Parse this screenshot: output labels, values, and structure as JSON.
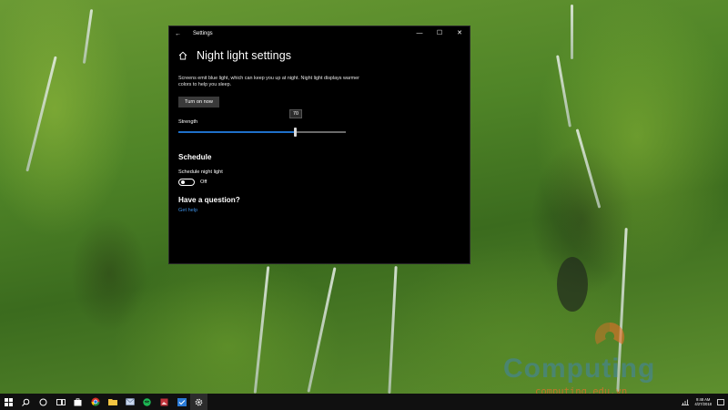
{
  "window": {
    "app_title": "Settings",
    "back_icon": "back-arrow-icon",
    "minimize_glyph": "—",
    "maximize_glyph": "☐",
    "close_glyph": "✕"
  },
  "page": {
    "home_icon": "home-icon",
    "title": "Night light settings",
    "description": "Screens emit blue light, which can keep you up at night. Night light displays warmer colors to help you sleep.",
    "turn_on_label": "Turn on now"
  },
  "strength": {
    "label": "Strength",
    "value": "70",
    "fraction": 0.7
  },
  "schedule": {
    "heading": "Schedule",
    "toggle_label": "Schedule night light",
    "toggle_state": "Off",
    "enabled": false
  },
  "help": {
    "heading": "Have a question?",
    "link_label": "Get help"
  },
  "watermark": {
    "brand": "Computing",
    "url": "computing.edu.vn"
  },
  "taskbar": {
    "items": [
      "windows-logo-icon",
      "search-icon",
      "cortana-icon",
      "task-view-icon",
      "store-icon",
      "chrome-icon",
      "file-explorer-icon",
      "mail-icon",
      "spotify-icon",
      "photos-icon",
      "app-icon",
      "settings-icon"
    ],
    "time": "9:48 AM",
    "date": "4/27/2018"
  },
  "colors": {
    "accent": "#1f70c9",
    "link": "#3b8de0",
    "window_bg": "#000000",
    "taskbar_bg": "#101010"
  }
}
